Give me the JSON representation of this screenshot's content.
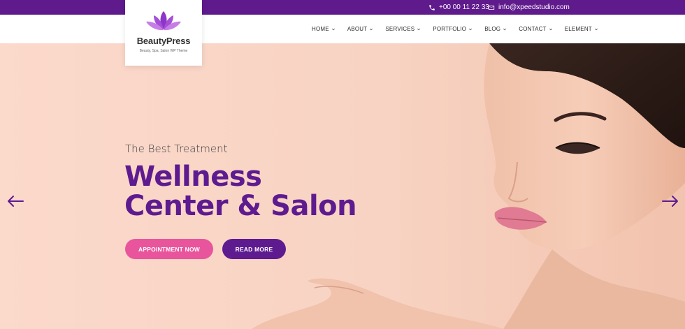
{
  "topbar": {
    "phone": "+00 00 11 22 33",
    "email": "info@xpeedstudio.com",
    "phone_icon": "phone-icon",
    "email_icon": "envelope-icon"
  },
  "logo": {
    "name": "BeautyPress",
    "tagline": "Beauty, Spa, Salon WP Theme",
    "icon": "lotus-icon"
  },
  "nav": {
    "items": [
      {
        "label": "HOME"
      },
      {
        "label": "ABOUT"
      },
      {
        "label": "SERVICES"
      },
      {
        "label": "PORTFOLIO"
      },
      {
        "label": "BLOG"
      },
      {
        "label": "CONTACT"
      },
      {
        "label": "ELEMENT"
      }
    ]
  },
  "hero": {
    "eyebrow": "The Best Treatment",
    "headline_line1": "Wellness",
    "headline_line2": "Center & Salon",
    "cta_primary": "APPOINTMENT NOW",
    "cta_secondary": "READ MORE",
    "prev_icon": "arrow-left-icon",
    "next_icon": "arrow-right-icon"
  },
  "colors": {
    "brand_purple": "#5e1b90",
    "topbar_purple": "#5f1a8c",
    "accent_pink": "#e8559c",
    "hero_bg": "#f8d3c3"
  }
}
